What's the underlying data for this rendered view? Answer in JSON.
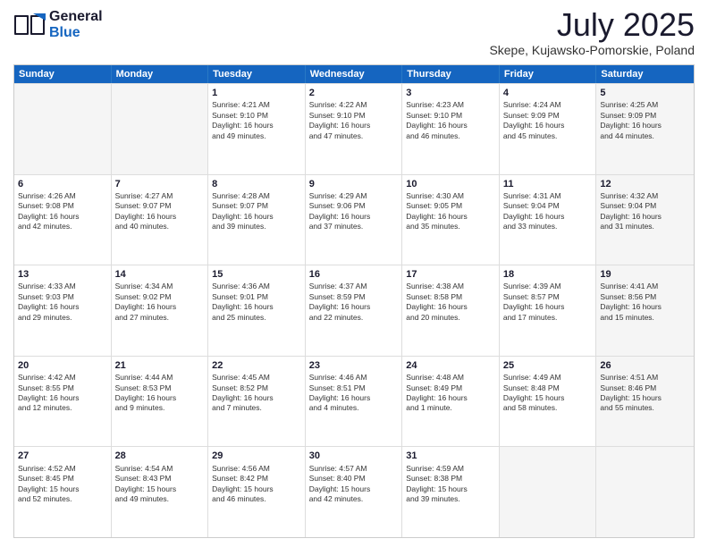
{
  "header": {
    "logo_line1": "General",
    "logo_line2": "Blue",
    "month_title": "July 2025",
    "subtitle": "Skepe, Kujawsko-Pomorskie, Poland"
  },
  "weekdays": [
    "Sunday",
    "Monday",
    "Tuesday",
    "Wednesday",
    "Thursday",
    "Friday",
    "Saturday"
  ],
  "rows": [
    [
      {
        "day": "",
        "info": "",
        "shaded": true
      },
      {
        "day": "",
        "info": "",
        "shaded": true
      },
      {
        "day": "1",
        "info": "Sunrise: 4:21 AM\nSunset: 9:10 PM\nDaylight: 16 hours\nand 49 minutes."
      },
      {
        "day": "2",
        "info": "Sunrise: 4:22 AM\nSunset: 9:10 PM\nDaylight: 16 hours\nand 47 minutes."
      },
      {
        "day": "3",
        "info": "Sunrise: 4:23 AM\nSunset: 9:10 PM\nDaylight: 16 hours\nand 46 minutes."
      },
      {
        "day": "4",
        "info": "Sunrise: 4:24 AM\nSunset: 9:09 PM\nDaylight: 16 hours\nand 45 minutes."
      },
      {
        "day": "5",
        "info": "Sunrise: 4:25 AM\nSunset: 9:09 PM\nDaylight: 16 hours\nand 44 minutes.",
        "shaded": true
      }
    ],
    [
      {
        "day": "6",
        "info": "Sunrise: 4:26 AM\nSunset: 9:08 PM\nDaylight: 16 hours\nand 42 minutes."
      },
      {
        "day": "7",
        "info": "Sunrise: 4:27 AM\nSunset: 9:07 PM\nDaylight: 16 hours\nand 40 minutes."
      },
      {
        "day": "8",
        "info": "Sunrise: 4:28 AM\nSunset: 9:07 PM\nDaylight: 16 hours\nand 39 minutes."
      },
      {
        "day": "9",
        "info": "Sunrise: 4:29 AM\nSunset: 9:06 PM\nDaylight: 16 hours\nand 37 minutes."
      },
      {
        "day": "10",
        "info": "Sunrise: 4:30 AM\nSunset: 9:05 PM\nDaylight: 16 hours\nand 35 minutes."
      },
      {
        "day": "11",
        "info": "Sunrise: 4:31 AM\nSunset: 9:04 PM\nDaylight: 16 hours\nand 33 minutes."
      },
      {
        "day": "12",
        "info": "Sunrise: 4:32 AM\nSunset: 9:04 PM\nDaylight: 16 hours\nand 31 minutes.",
        "shaded": true
      }
    ],
    [
      {
        "day": "13",
        "info": "Sunrise: 4:33 AM\nSunset: 9:03 PM\nDaylight: 16 hours\nand 29 minutes."
      },
      {
        "day": "14",
        "info": "Sunrise: 4:34 AM\nSunset: 9:02 PM\nDaylight: 16 hours\nand 27 minutes."
      },
      {
        "day": "15",
        "info": "Sunrise: 4:36 AM\nSunset: 9:01 PM\nDaylight: 16 hours\nand 25 minutes."
      },
      {
        "day": "16",
        "info": "Sunrise: 4:37 AM\nSunset: 8:59 PM\nDaylight: 16 hours\nand 22 minutes."
      },
      {
        "day": "17",
        "info": "Sunrise: 4:38 AM\nSunset: 8:58 PM\nDaylight: 16 hours\nand 20 minutes."
      },
      {
        "day": "18",
        "info": "Sunrise: 4:39 AM\nSunset: 8:57 PM\nDaylight: 16 hours\nand 17 minutes."
      },
      {
        "day": "19",
        "info": "Sunrise: 4:41 AM\nSunset: 8:56 PM\nDaylight: 16 hours\nand 15 minutes.",
        "shaded": true
      }
    ],
    [
      {
        "day": "20",
        "info": "Sunrise: 4:42 AM\nSunset: 8:55 PM\nDaylight: 16 hours\nand 12 minutes."
      },
      {
        "day": "21",
        "info": "Sunrise: 4:44 AM\nSunset: 8:53 PM\nDaylight: 16 hours\nand 9 minutes."
      },
      {
        "day": "22",
        "info": "Sunrise: 4:45 AM\nSunset: 8:52 PM\nDaylight: 16 hours\nand 7 minutes."
      },
      {
        "day": "23",
        "info": "Sunrise: 4:46 AM\nSunset: 8:51 PM\nDaylight: 16 hours\nand 4 minutes."
      },
      {
        "day": "24",
        "info": "Sunrise: 4:48 AM\nSunset: 8:49 PM\nDaylight: 16 hours\nand 1 minute."
      },
      {
        "day": "25",
        "info": "Sunrise: 4:49 AM\nSunset: 8:48 PM\nDaylight: 15 hours\nand 58 minutes."
      },
      {
        "day": "26",
        "info": "Sunrise: 4:51 AM\nSunset: 8:46 PM\nDaylight: 15 hours\nand 55 minutes.",
        "shaded": true
      }
    ],
    [
      {
        "day": "27",
        "info": "Sunrise: 4:52 AM\nSunset: 8:45 PM\nDaylight: 15 hours\nand 52 minutes."
      },
      {
        "day": "28",
        "info": "Sunrise: 4:54 AM\nSunset: 8:43 PM\nDaylight: 15 hours\nand 49 minutes."
      },
      {
        "day": "29",
        "info": "Sunrise: 4:56 AM\nSunset: 8:42 PM\nDaylight: 15 hours\nand 46 minutes."
      },
      {
        "day": "30",
        "info": "Sunrise: 4:57 AM\nSunset: 8:40 PM\nDaylight: 15 hours\nand 42 minutes."
      },
      {
        "day": "31",
        "info": "Sunrise: 4:59 AM\nSunset: 8:38 PM\nDaylight: 15 hours\nand 39 minutes."
      },
      {
        "day": "",
        "info": "",
        "shaded": true
      },
      {
        "day": "",
        "info": "",
        "shaded": true
      }
    ]
  ]
}
